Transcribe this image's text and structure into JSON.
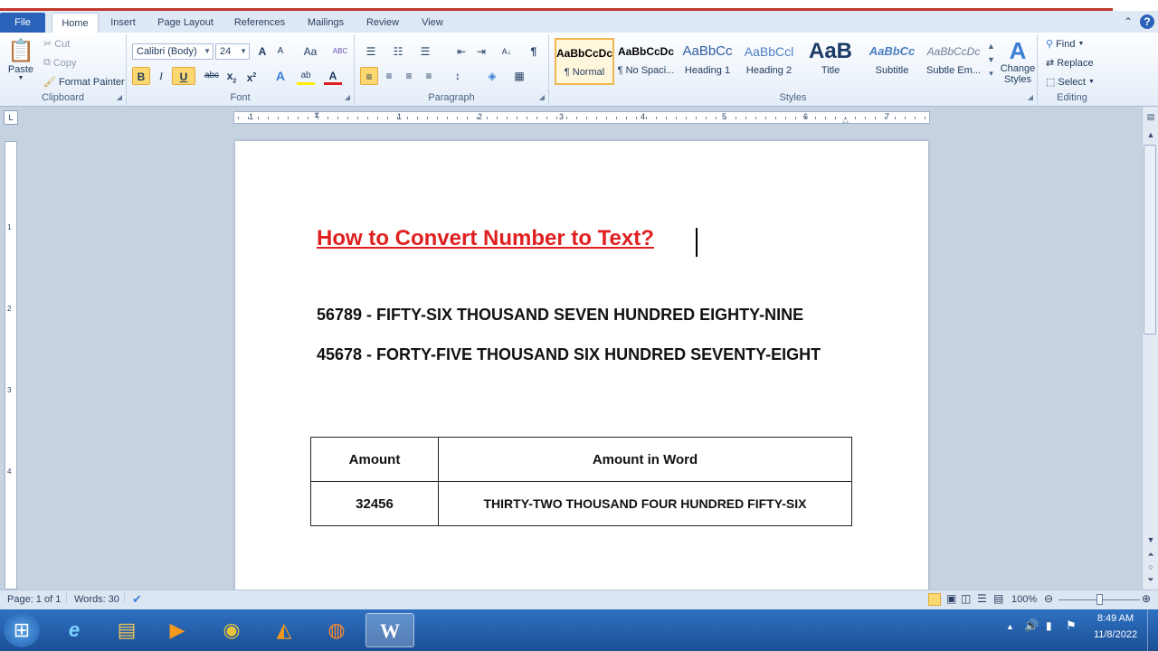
{
  "tabs": [
    {
      "label": "File"
    },
    {
      "label": "Home"
    },
    {
      "label": "Insert"
    },
    {
      "label": "Page Layout"
    },
    {
      "label": "References"
    },
    {
      "label": "Mailings"
    },
    {
      "label": "Review"
    },
    {
      "label": "View"
    }
  ],
  "window": {
    "minimize": "─",
    "restore": "▢",
    "close": "✕",
    "help": "?",
    "collapse": "⌃"
  },
  "clipboard": {
    "label": "Clipboard",
    "paste": "Paste",
    "cut": "Cut",
    "copy": "Copy",
    "format_painter": "Format Painter"
  },
  "font": {
    "label": "Font",
    "name": "Calibri (Body)",
    "size": "24",
    "grow": "A",
    "shrink": "A",
    "case": "Aa",
    "clear": "ABC",
    "bold": "B",
    "italic": "I",
    "underline": "U",
    "strike": "abc",
    "sub": "x",
    "sup": "x",
    "effects": "A",
    "highlight": "ab",
    "color": "A",
    "sub_mark": "2",
    "sup_mark": "2"
  },
  "paragraph": {
    "label": "Paragraph",
    "bullets": "☰",
    "numbering": "☷",
    "multilevel": "☰",
    "dec_indent": "⇤",
    "inc_indent": "⇥",
    "sort": "A↓",
    "show": "¶",
    "align_left": "≡",
    "center": "≡",
    "align_right": "≡",
    "justify": "≡",
    "spacing": "↕",
    "shading": "◈",
    "borders": "▦"
  },
  "styles": {
    "label": "Styles",
    "items": [
      {
        "preview": "AaBbCcDc",
        "name": "¶ Normal"
      },
      {
        "preview": "AaBbCcDc",
        "name": "¶ No Spaci..."
      },
      {
        "preview": "AaBbCc",
        "name": "Heading 1"
      },
      {
        "preview": "AaBbCcl",
        "name": "Heading 2"
      },
      {
        "preview": "AaB",
        "name": "Title"
      },
      {
        "preview": "AaBbCc",
        "name": "Subtitle"
      },
      {
        "preview": "AaBbCcDc",
        "name": "Subtle Em..."
      }
    ],
    "change_styles": "Change Styles",
    "change_icon": "A"
  },
  "editing": {
    "label": "Editing",
    "find": "Find",
    "replace": "Replace",
    "select": "Select"
  },
  "ruler": {
    "corner": "L",
    "numbers": [
      "1",
      "1",
      "2",
      "3",
      "4",
      "5",
      "6",
      "7"
    ],
    "vnumbers": [
      "1",
      "2",
      "3",
      "4"
    ]
  },
  "document": {
    "title": "How to Convert Number to Text?",
    "lines": [
      "56789 - FIFTY-SIX  THOUSAND SEVEN HUNDRED EIGHTY-NINE",
      "45678 - FORTY-FIVE THOUSAND SIX HUNDRED SEVENTY-EIGHT"
    ],
    "table": {
      "headers": [
        "Amount",
        "Amount in Word"
      ],
      "rows": [
        [
          "32456",
          "THIRTY-TWO THOUSAND FOUR HUNDRED FIFTY-SIX"
        ]
      ]
    }
  },
  "status": {
    "page": "Page: 1 of 1",
    "words": "Words: 30",
    "zoom": "100%",
    "zoom_level": 100
  },
  "taskbar": {
    "time": "8:49 AM",
    "date": "11/8/2022",
    "start": "⊞",
    "ie": "e",
    "explorer": "▤",
    "media": "▶",
    "chrome": "◉",
    "vlc": "◭",
    "firefox": "◍",
    "word": "W",
    "tray_up": "▲",
    "volume": "🔊",
    "network": "▮",
    "flag": "⚑"
  },
  "colors": {
    "title_red": "#e02020",
    "file_tab": "#2a62b9",
    "taskbar": "#1b4f95"
  }
}
